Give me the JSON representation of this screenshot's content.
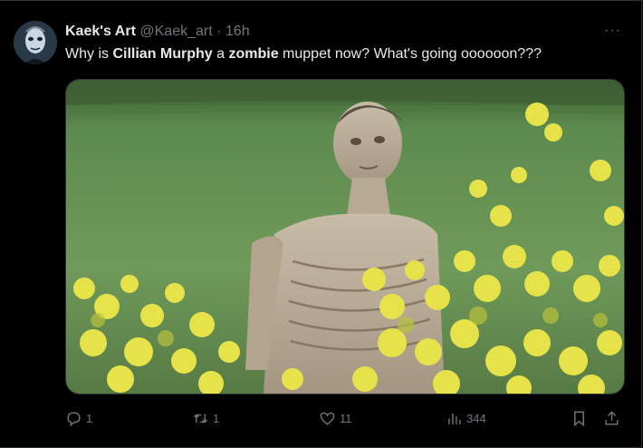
{
  "tweet": {
    "author_name": "Kaek's Art",
    "handle": "@Kaek_art",
    "separator": "·",
    "time": "16h",
    "more_label": "···",
    "text_parts": [
      {
        "t": "Why is ",
        "bold": false
      },
      {
        "t": "Cillian Murphy",
        "bold": true
      },
      {
        "t": " a ",
        "bold": false
      },
      {
        "t": "zombie",
        "bold": true
      },
      {
        "t": " muppet now? What's going oooooon???",
        "bold": false
      }
    ],
    "media_icon": "zombie-in-rapeseed-field-photo"
  },
  "actions": {
    "reply_count": "1",
    "retweet_count": "1",
    "like_count": "11",
    "views_count": "344",
    "icons": [
      "reply-icon",
      "retweet-icon",
      "like-icon",
      "views-icon",
      "bookmark-icon",
      "share-icon"
    ]
  },
  "colors": {
    "background": "#000000",
    "text": "#e7e9ea",
    "muted": "#71767b",
    "border": "#2f3336"
  }
}
